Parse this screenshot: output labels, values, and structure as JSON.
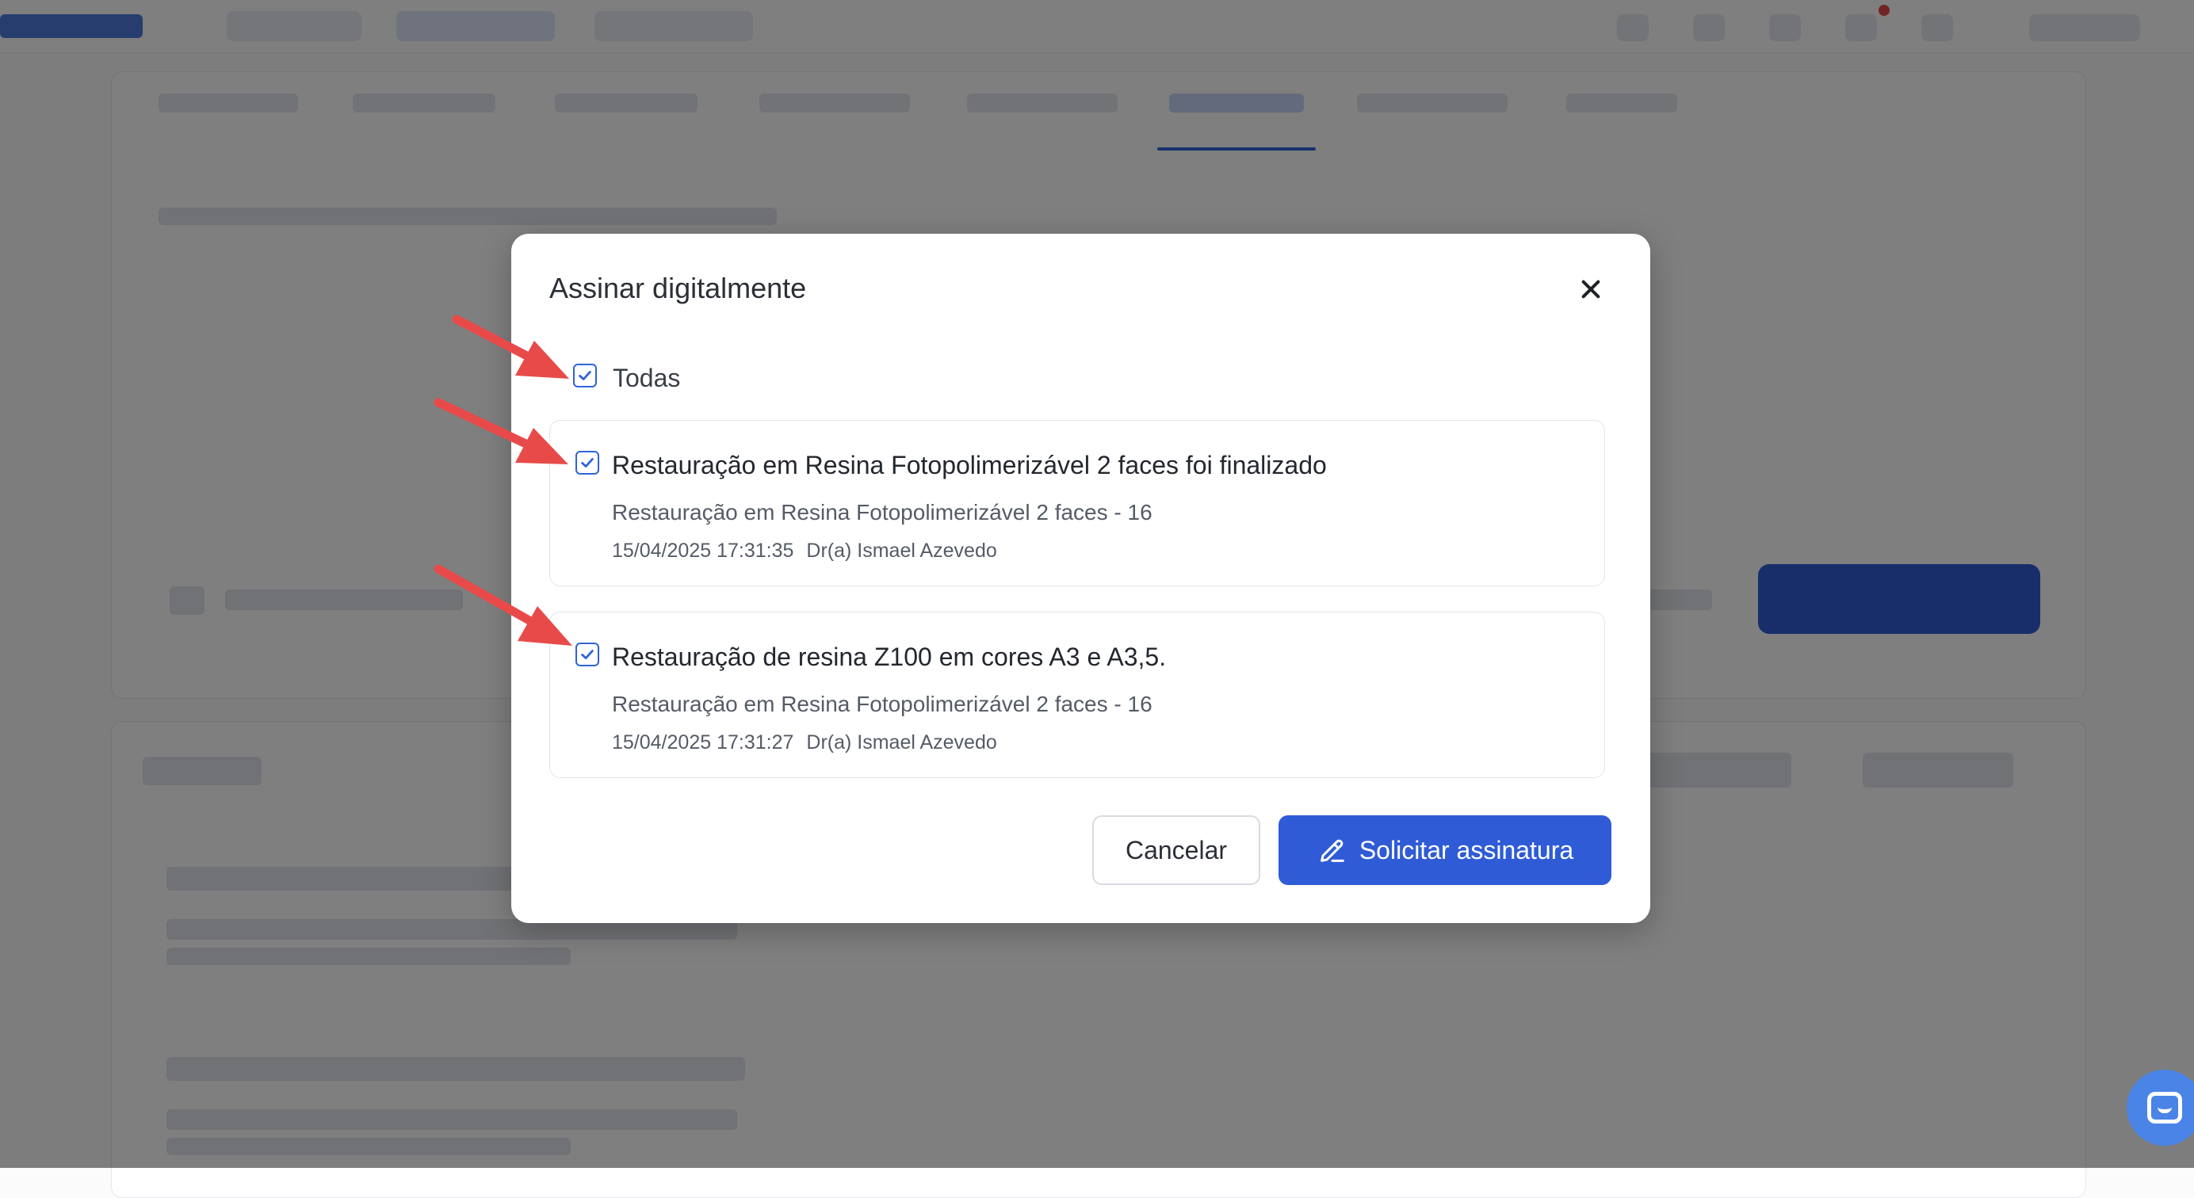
{
  "modal": {
    "title": "Assinar digitalmente",
    "select_all_label": "Todas",
    "items": [
      {
        "title": "Restauração em Resina Fotopolimerizável 2 faces foi finalizado",
        "subtitle": "Restauração em Resina Fotopolimerizável 2 faces - 16",
        "datetime": "15/04/2025 17:31:35",
        "doctor": "Dr(a) Ismael Azevedo",
        "checked": true
      },
      {
        "title": "Restauração de resina Z100 em cores A3 e A3,5.",
        "subtitle": "Restauração em Resina Fotopolimerizável 2 faces - 16",
        "datetime": "15/04/2025 17:31:27",
        "doctor": "Dr(a) Ismael Azevedo",
        "checked": true
      }
    ],
    "cancel_label": "Cancelar",
    "submit_label": "Solicitar assinatura"
  },
  "icons": {
    "close": "close-icon",
    "checkbox": "checkmark-icon",
    "submit": "pen-icon",
    "chat": "chat-icon"
  },
  "colors": {
    "accent": "#2f5cd6",
    "annotation_arrow": "#e84a4a",
    "overlay": "rgba(0,0,0,0.5)"
  }
}
